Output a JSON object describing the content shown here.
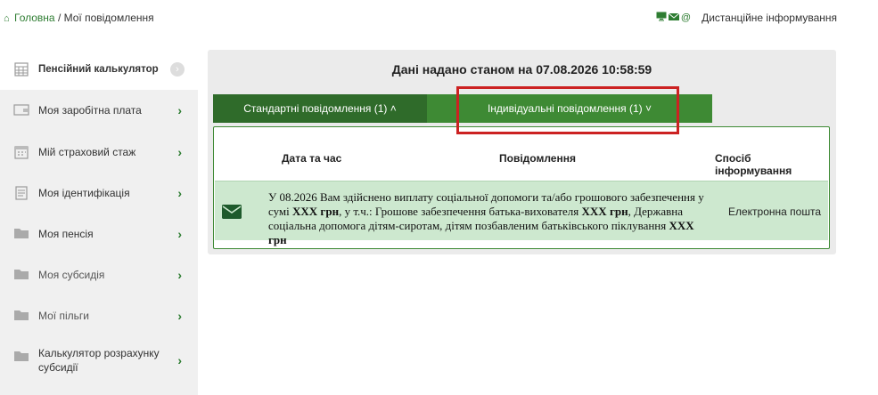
{
  "breadcrumb": {
    "home": "Головна",
    "separator": " / ",
    "current": "Мої повідомлення"
  },
  "top_right": {
    "label": "Дистанційне інформування",
    "icons": [
      "monitor-icon",
      "envelope-icon",
      "at-icon"
    ]
  },
  "sidebar": {
    "items": [
      {
        "label": "Пенсійний калькулятор",
        "icon": "calculator-icon",
        "active": true
      },
      {
        "label": "Моя заробітна плата",
        "icon": "wallet-icon"
      },
      {
        "label": "Мій страховий стаж",
        "icon": "calendar-icon"
      },
      {
        "label": "Моя ідентифікація",
        "icon": "document-icon"
      },
      {
        "label": "Моя пенсія",
        "icon": "folder-icon"
      },
      {
        "label": "Моя субсидія",
        "icon": "folder-icon"
      },
      {
        "label": "Мої пільги",
        "icon": "folder-icon"
      },
      {
        "label": "Калькулятор розрахунку субсидії",
        "icon": "folder-icon"
      }
    ]
  },
  "main": {
    "title": "Дані надано станом на 07.08.2026 10:58:59",
    "tabs": {
      "standard": "Стандартні повідомлення (1) ˄",
      "individual": "Індивідуальні повідомлення (1) ˅"
    },
    "table": {
      "headers": {
        "date": "Дата та час",
        "message": "Повідомлення",
        "method": "Спосіб інформування"
      },
      "rows": [
        {
          "icon": "envelope-icon",
          "text_parts": [
            "У 08.2026 Вам здійснено виплату соціальної допомоги та/або грошового забезпечення у сумі ",
            "XXX грн",
            ", у т.ч.: Грошове забезпечення батька-вихователя ",
            "XXX грн",
            ", Державна соціальна допомога дітям-сиротам, дітям позбавленим батьківського піклування ",
            "XXX грн"
          ],
          "method": "Електронна пошта"
        }
      ]
    }
  },
  "colors": {
    "accent": "#2e7d32",
    "tab_dark": "#2f6b2a",
    "tab_light": "#3e8a34",
    "row_bg": "#cde8cf",
    "highlight": "#cc2222"
  }
}
